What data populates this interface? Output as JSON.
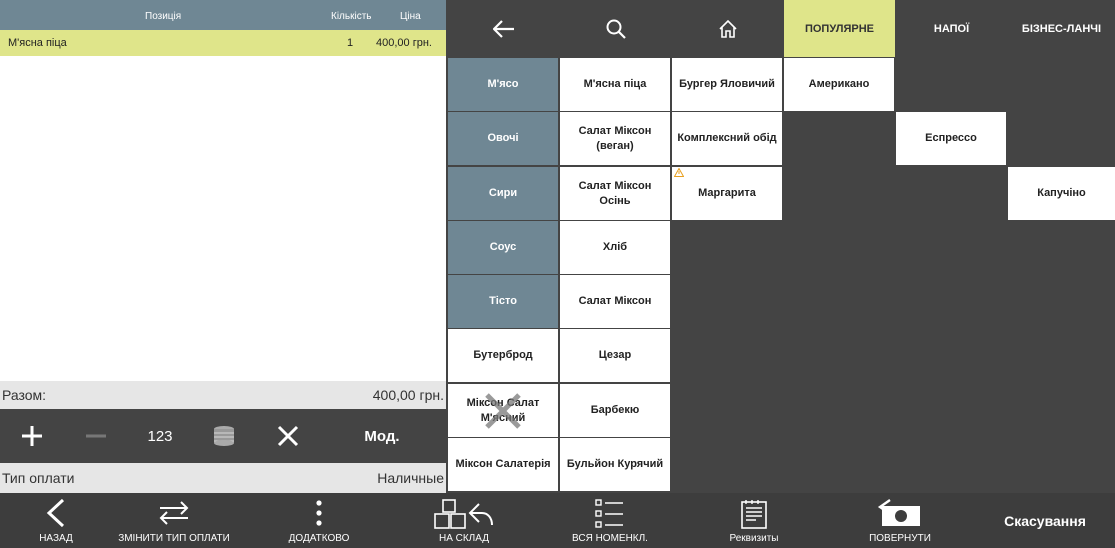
{
  "order": {
    "headers": {
      "position": "Позиція",
      "qty": "Кількість",
      "price": "Ціна"
    },
    "rows": [
      {
        "name": "М'ясна піца",
        "qty": "1",
        "price": "400,00 грн."
      }
    ],
    "total_label": "Разом:",
    "total_value": "400,00 грн.",
    "tools": {
      "qty_label": "123",
      "mod_label": "Мод."
    },
    "pay_type_label": "Тип оплати",
    "pay_type_value": "Наличные"
  },
  "catalog": {
    "nav": {
      "tabs": [
        "ПОПУЛЯРНЕ",
        "НАПОЇ",
        "БІЗНЕС-ЛАНЧІ"
      ]
    },
    "categories": [
      "М'ясо",
      "Овочі",
      "Сири",
      "Соус",
      "Тісто",
      "Бутерброд",
      "Міксон Салат М'ясний",
      "Міксон Салатерія"
    ],
    "col2": [
      "М'ясна піца",
      "Салат Міксон (веган)",
      "Салат Міксон Осінь",
      "Хліб",
      "Салат Міксон",
      "Цезар",
      "Барбекю",
      "Бульйон Курячий"
    ],
    "col3": [
      "Бургер Яловичий",
      "Комплексний обід",
      "Маргарита"
    ],
    "popular": "Американо",
    "drinks": "Еспрессо",
    "lunch": "Капучіно"
  },
  "bottombar": {
    "back": "НАЗАД",
    "change_pay": "ЗМІНИТИ ТИП ОПЛАТИ",
    "more": "ДОДАТКОВО",
    "to_stock": "НА СКЛАД",
    "all_items": "ВСЯ НОМЕНКЛ.",
    "requisites": "Реквизиты",
    "refund": "ПОВЕРНУТИ",
    "cancel": "Скасування"
  },
  "colors": {
    "accent": "#dfe58a",
    "category": "#6f8794",
    "dark": "#444444"
  }
}
